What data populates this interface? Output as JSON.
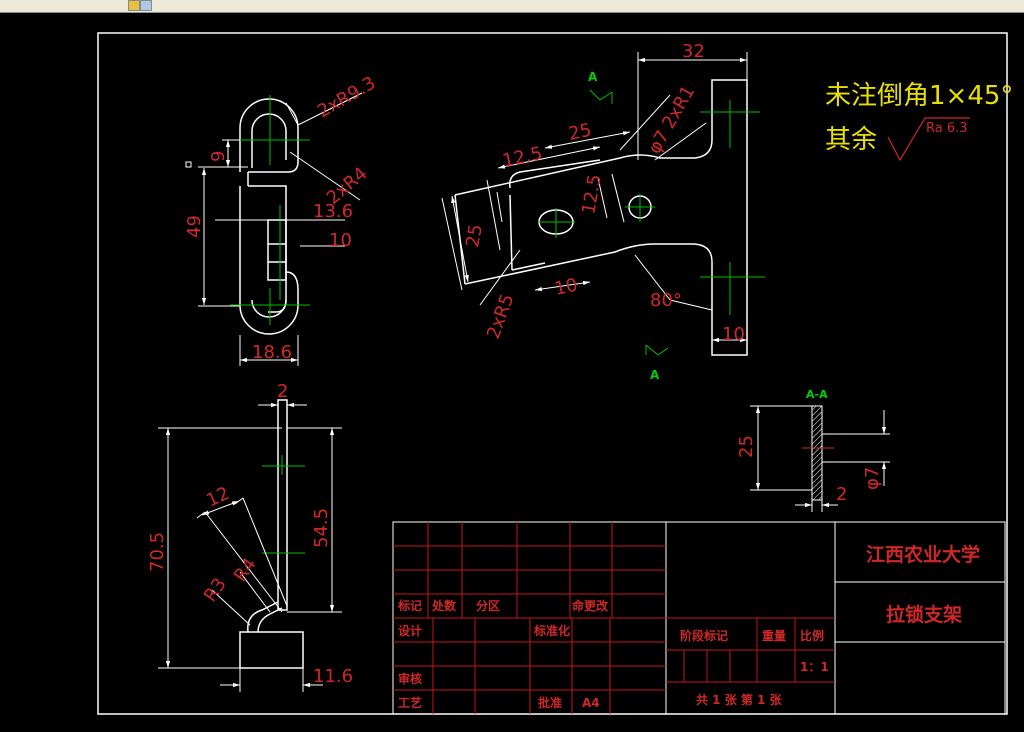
{
  "toolbar": {
    "icons": [
      "draw-tool-icon",
      "layer-icon"
    ]
  },
  "drawing": {
    "notes": {
      "chamfer_note": "未注倒角1×45°",
      "other_note": "其余",
      "roughness": "Ra 6.3"
    },
    "top_view_dims": [
      "2xR9.3",
      "2xR4",
      "9",
      "49",
      "13.6",
      "10",
      "18.6"
    ],
    "main_view_dims": [
      "32",
      "2xR1",
      "25",
      "12.5",
      "φ7",
      "12.5",
      "25",
      "2xR5",
      "10",
      "80°",
      "10"
    ],
    "section_labels": {
      "view_a1": "A",
      "view_a2": "A",
      "section_title": "A-A"
    },
    "section_dims": [
      "25",
      "2",
      "φ7"
    ],
    "side_view_dims": [
      "2",
      "70.5",
      "54.5",
      "12",
      "R4",
      "R3",
      "11.6"
    ]
  },
  "title_block": {
    "school": "江西农业大学",
    "part_name": "拉锁支架",
    "labels": {
      "mark": "标记",
      "count": "处数",
      "zone": "分区",
      "doc_no": "命更改",
      "design": "设计",
      "standard": "标准化",
      "review": "审核",
      "process": "工艺",
      "approve": "批准",
      "size": "A4",
      "stage_mark": "阶段标记",
      "weight": "重量",
      "scale": "比例",
      "scale_value": "1：1",
      "sheets": "共 1 张  第 1 张"
    }
  },
  "colors": {
    "line": "#ffffff",
    "dimension": "#d02828",
    "centerline": "#00c000",
    "note": "#e8e000",
    "background": "#000000"
  }
}
